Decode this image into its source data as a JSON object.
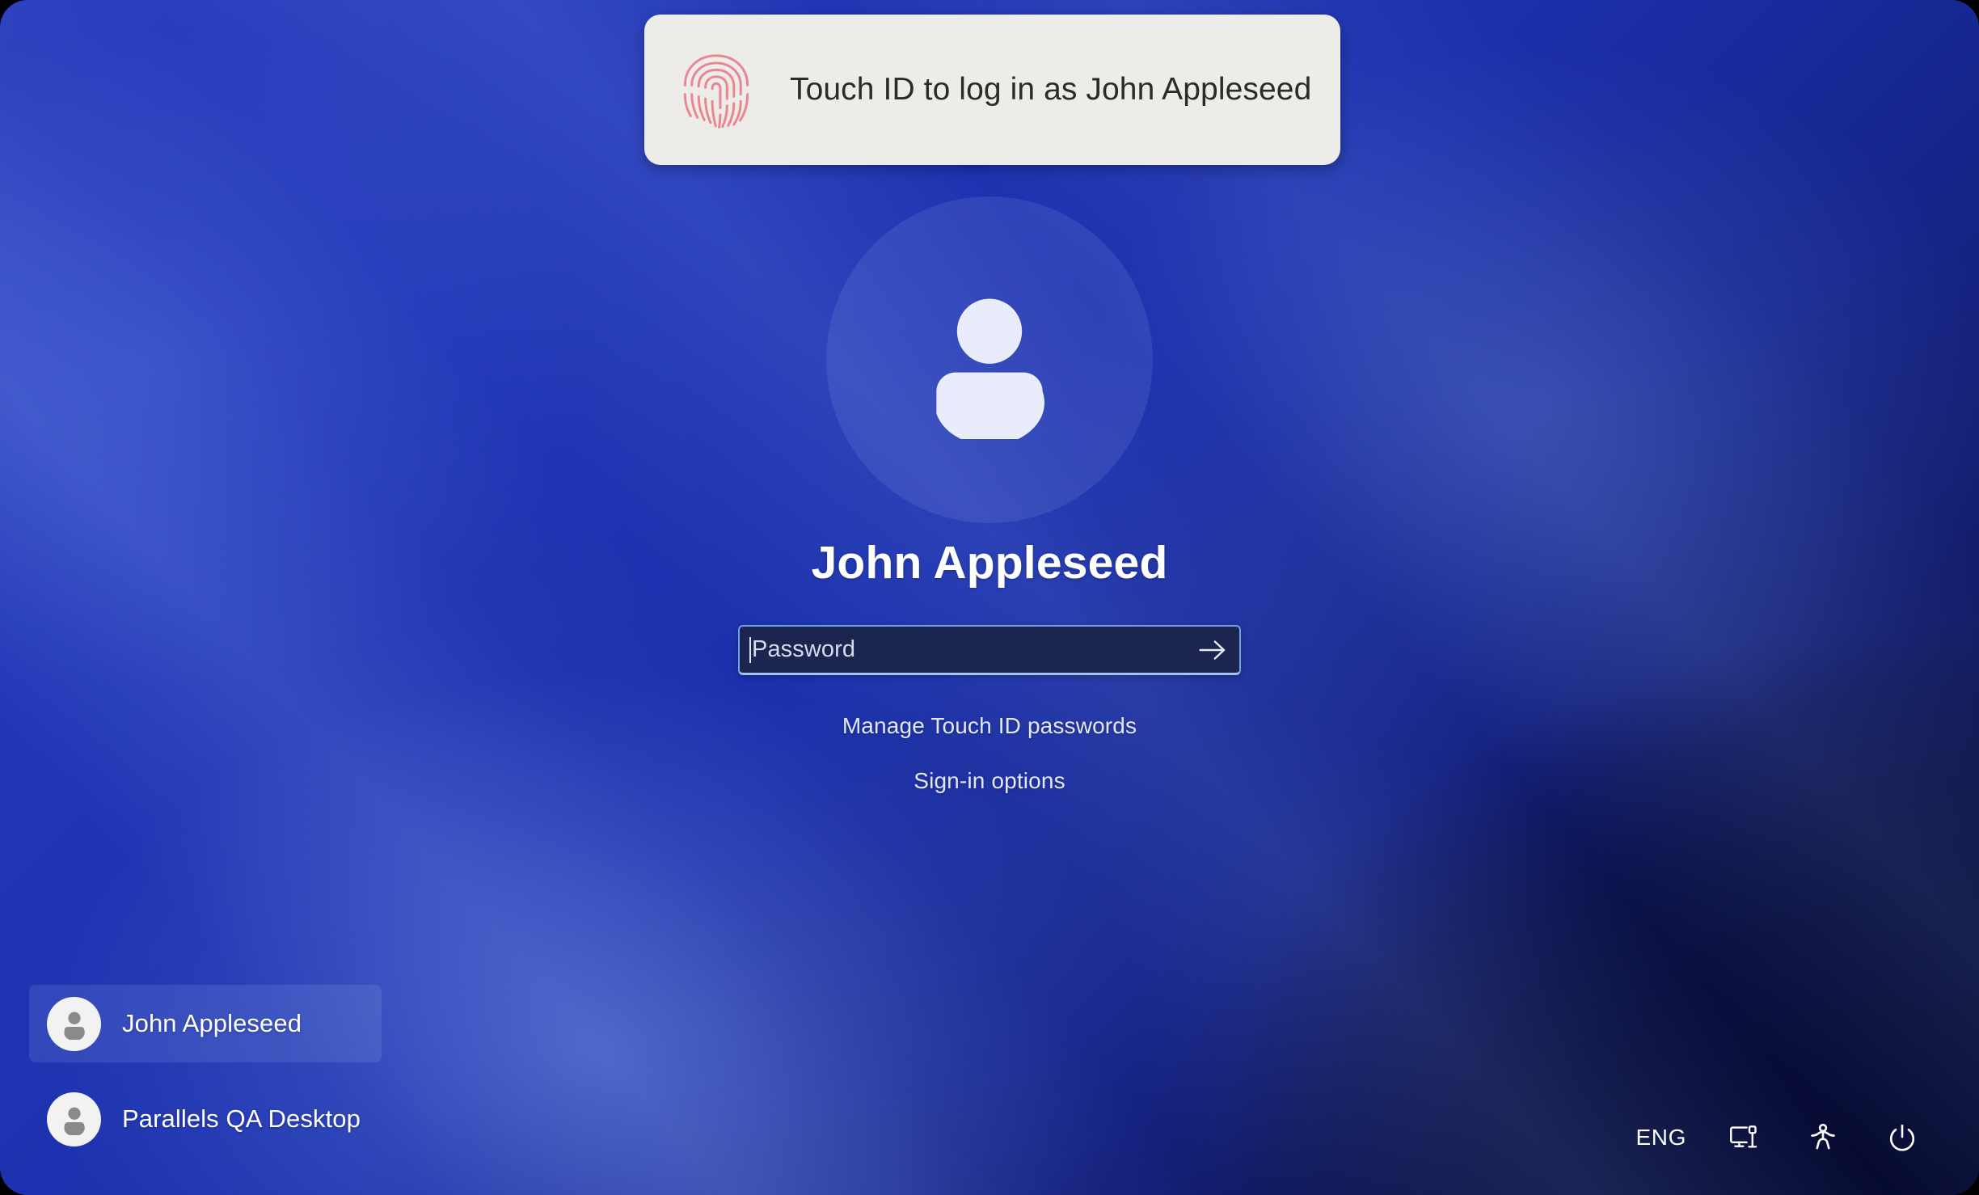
{
  "toast": {
    "icon": "fingerprint-icon",
    "message": "Touch ID to log in as John Appleseed",
    "bg_color": "#edece8",
    "fingerprint_color": "#e8878f"
  },
  "login": {
    "avatar_icon": "user-avatar-icon",
    "user_name": "John Appleseed",
    "password": {
      "value": "",
      "placeholder": "Password",
      "submit_icon": "arrow-right-icon",
      "field_bg": "#1c2550",
      "field_border": "#6fa3e8"
    },
    "links": [
      {
        "label": "Manage Touch ID passwords",
        "name": "manage-touch-id-passwords-link"
      },
      {
        "label": "Sign-in options",
        "name": "sign-in-options-link"
      }
    ]
  },
  "user_switcher": {
    "items": [
      {
        "label": "John Appleseed",
        "selected": true,
        "icon": "user-avatar-icon"
      },
      {
        "label": "Parallels QA Desktop",
        "selected": false,
        "icon": "user-avatar-icon"
      }
    ]
  },
  "tray": {
    "language": "ENG",
    "items": [
      {
        "name": "language-indicator",
        "label": "ENG"
      },
      {
        "name": "network-ethernet-icon",
        "label": ""
      },
      {
        "name": "accessibility-icon",
        "label": ""
      },
      {
        "name": "power-icon",
        "label": ""
      }
    ]
  },
  "theme": {
    "background_top_left": "#2b3fbf",
    "background_bottom_right": "#0b1140",
    "accent": "#6fa3e8",
    "text_primary": "#ffffff"
  }
}
